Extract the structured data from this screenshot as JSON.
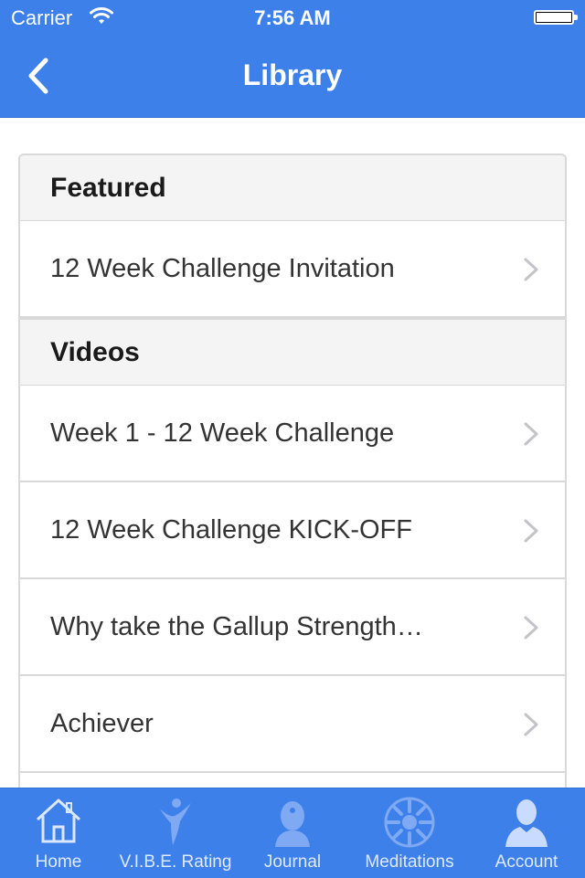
{
  "status_bar": {
    "carrier": "Carrier",
    "time": "7:56 AM"
  },
  "nav": {
    "title": "Library",
    "back_icon": "chevron-left-icon"
  },
  "sections": [
    {
      "header": "Featured",
      "items": [
        "12 Week Challenge Invitation"
      ]
    },
    {
      "header": "Videos",
      "items": [
        "Week 1 - 12 Week Challenge",
        "12 Week Challenge KICK-OFF",
        "Why take the Gallup Strength…",
        "Achiever"
      ]
    }
  ],
  "tabs": [
    {
      "label": "Home",
      "icon": "house-icon"
    },
    {
      "label": "V.I.B.E. Rating",
      "icon": "figure-icon"
    },
    {
      "label": "Journal",
      "icon": "head-icon"
    },
    {
      "label": "Meditations",
      "icon": "mandala-icon"
    },
    {
      "label": "Account",
      "icon": "person-icon"
    }
  ],
  "colors": {
    "accent": "#3d80ea",
    "header_bg": "#f4f4f4",
    "border": "#d9d9d9"
  }
}
